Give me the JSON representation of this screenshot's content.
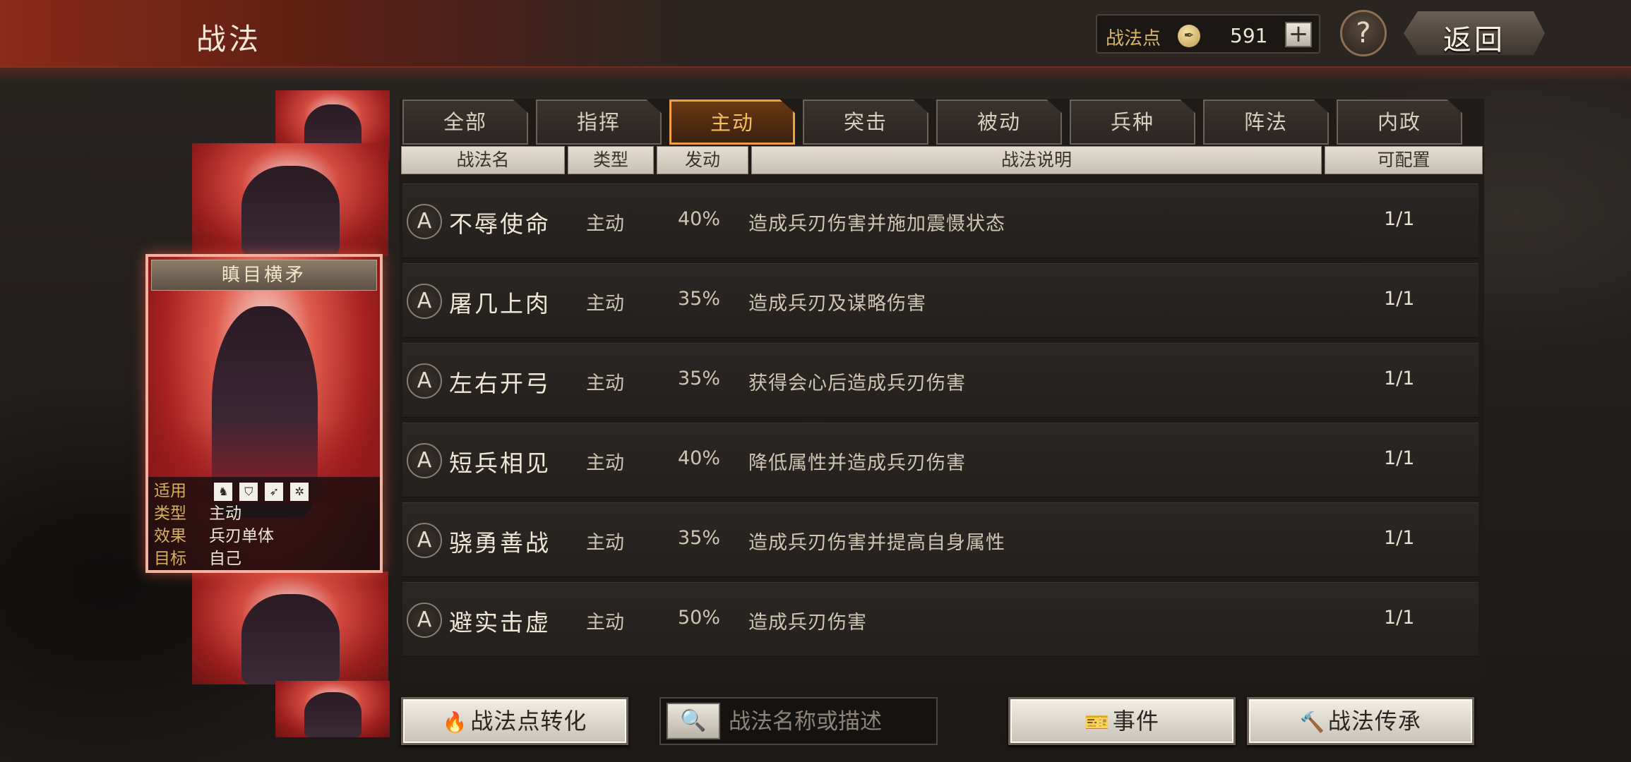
{
  "header": {
    "title": "战法",
    "points_label": "战法点",
    "points_value": "591",
    "plus_label": "+",
    "help_label": "?",
    "back_label": "返回"
  },
  "card": {
    "name": "瞋目横矛",
    "info": [
      {
        "key": "适用",
        "value": ""
      },
      {
        "key": "类型",
        "value": "主动"
      },
      {
        "key": "效果",
        "value": "兵刃单体"
      },
      {
        "key": "目标",
        "value": "自己"
      }
    ],
    "unit_icons": [
      "cavalry-icon",
      "shield-icon",
      "bow-icon",
      "chariot-icon"
    ]
  },
  "tabs": [
    "全部",
    "指挥",
    "主动",
    "突击",
    "被动",
    "兵种",
    "阵法",
    "内政"
  ],
  "active_tab": "主动",
  "columns": [
    "战法名",
    "类型",
    "发动",
    "战法说明",
    "可配置"
  ],
  "rows": [
    {
      "badge": "A",
      "name": "不辱使命",
      "type": "主动",
      "rate": "40%",
      "desc": "造成兵刃伤害并施加震慑状态",
      "count": "1/1"
    },
    {
      "badge": "A",
      "name": "屠几上肉",
      "type": "主动",
      "rate": "35%",
      "desc": "造成兵刃及谋略伤害",
      "count": "1/1"
    },
    {
      "badge": "A",
      "name": "左右开弓",
      "type": "主动",
      "rate": "35%",
      "desc": "获得会心后造成兵刃伤害",
      "count": "1/1"
    },
    {
      "badge": "A",
      "name": "短兵相见",
      "type": "主动",
      "rate": "40%",
      "desc": "降低属性并造成兵刃伤害",
      "count": "1/1"
    },
    {
      "badge": "A",
      "name": "骁勇善战",
      "type": "主动",
      "rate": "35%",
      "desc": "造成兵刃伤害并提高自身属性",
      "count": "1/1"
    },
    {
      "badge": "A",
      "name": "避实击虚",
      "type": "主动",
      "rate": "50%",
      "desc": "造成兵刃伤害",
      "count": "1/1"
    }
  ],
  "bottom": {
    "convert_label": "战法点转化",
    "search_placeholder": "战法名称或描述",
    "events_label": "事件",
    "inherit_label": "战法传承"
  }
}
